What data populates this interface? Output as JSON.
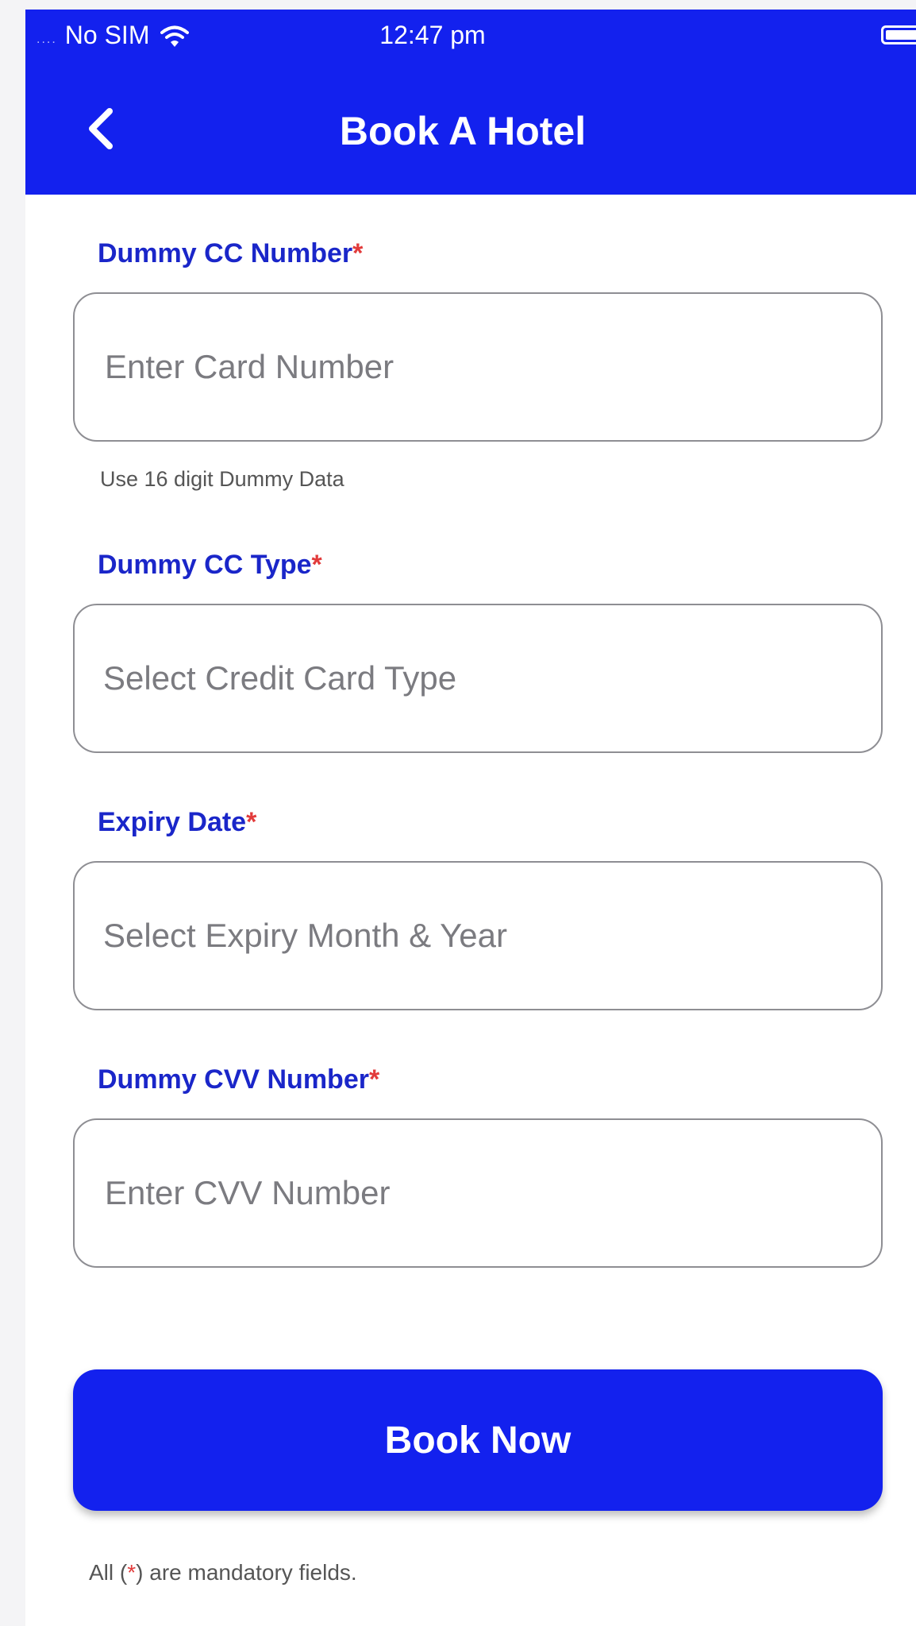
{
  "status_bar": {
    "signal": "....",
    "carrier": "No SIM",
    "time": "12:47 pm",
    "wifi_icon": "wifi-icon",
    "battery_icon": "battery-icon"
  },
  "nav": {
    "back_icon": "chevron-left-icon",
    "title": "Book A Hotel"
  },
  "form": {
    "card_number": {
      "label": "Dummy CC Number",
      "required_mark": "*",
      "placeholder": "Enter Card Number",
      "value": "",
      "helper": "Use 16 digit Dummy Data"
    },
    "card_type": {
      "label": "Dummy CC Type",
      "required_mark": "*",
      "placeholder": "Select Credit Card Type"
    },
    "expiry": {
      "label": "Expiry Date",
      "required_mark": "*",
      "placeholder": "Select Expiry Month & Year"
    },
    "cvv": {
      "label": "Dummy CVV Number",
      "required_mark": "*",
      "placeholder": "Enter CVV Number",
      "value": ""
    }
  },
  "actions": {
    "book_now_label": "Book Now"
  },
  "footer": {
    "prefix": "All (",
    "star": "*",
    "suffix": ") are mandatory fields."
  },
  "colors": {
    "primary": "#1321ee",
    "label": "#1a26c9",
    "required": "#e23b3b"
  }
}
